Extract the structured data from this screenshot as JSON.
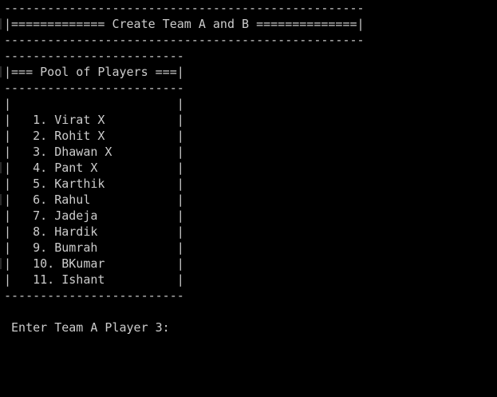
{
  "console": {
    "header": {
      "border_top": "--------------------------------------------------",
      "title_line": "|============= Create Team A and B ==============|",
      "border_bottom": "--------------------------------------------------"
    },
    "pool": {
      "border_top": "-------------------------",
      "title_line": "|=== Pool of Players ===|",
      "border_mid": "-------------------------",
      "blank_line": "|                       |",
      "players": [
        "|   1. Virat X          |",
        "|   2. Rohit X          |",
        "|   3. Dhawan X         |",
        "|   4. Pant X           |",
        "|   5. Karthik          |",
        "|   6. Rahul            |",
        "|   7. Jadeja           |",
        "|   8. Hardik           |",
        "|   9. Bumrah           |",
        "|   10. BKumar          |",
        "|   11. Ishant          |"
      ],
      "border_bottom": "-------------------------"
    },
    "prompt": " Enter Team A Player 3:"
  },
  "colors": {
    "background": "#000000",
    "text": "#cccccc"
  }
}
